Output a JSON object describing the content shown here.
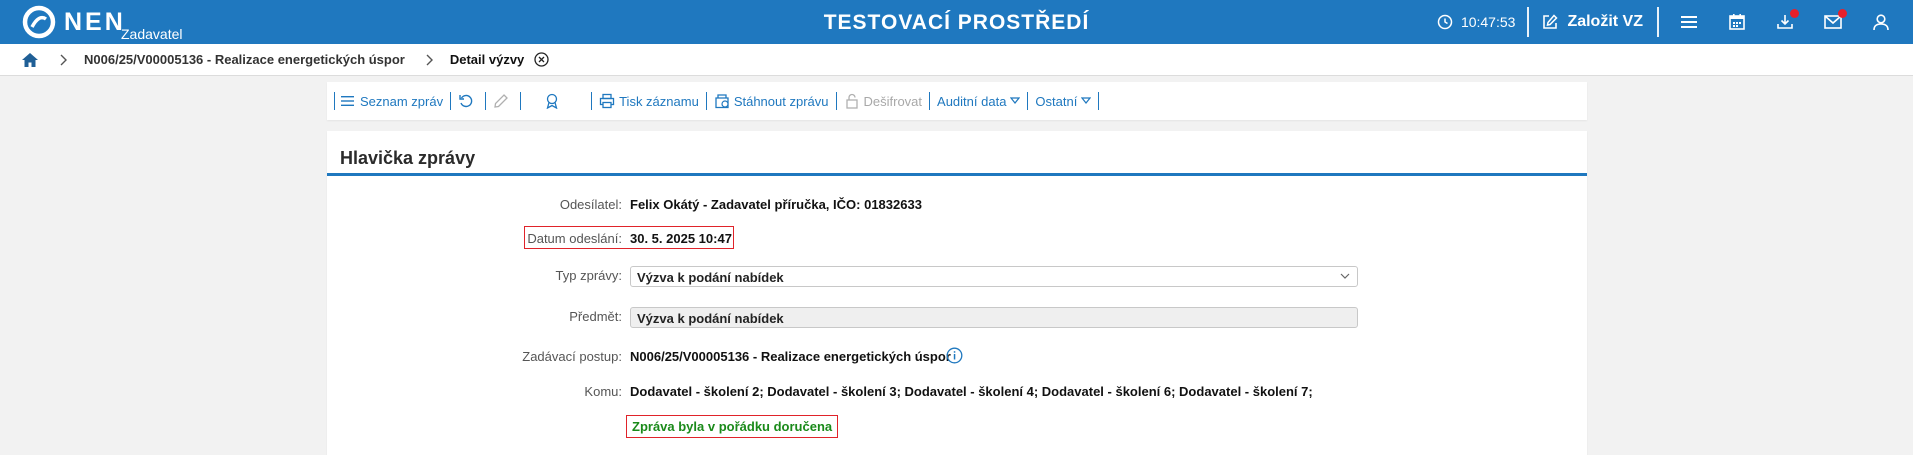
{
  "topbar": {
    "logo_text": "NEN",
    "logo_sub": "Zadavatel",
    "env_title": "TESTOVACÍ PROSTŘEDÍ",
    "time": "10:47:53",
    "create_label": "Založit VZ",
    "icons": [
      "menu-icon",
      "calendar-icon",
      "download-icon",
      "mail-icon",
      "user-icon"
    ],
    "accent_color": "#1f78bf",
    "notification_color": "#e8202a"
  },
  "breadcrumb": {
    "link": "N006/25/V00005136 - Realizace energetických úspor",
    "current": "Detail výzvy"
  },
  "toolbar": {
    "list": "Seznam zpráv",
    "print": "Tisk záznamu",
    "download": "Stáhnout zprávu",
    "decrypt": "Dešifrovat",
    "audit": "Auditní data",
    "other": "Ostatní"
  },
  "header": {
    "title": "Hlavička zprávy",
    "sender_label": "Odesílatel:",
    "sender_value": "Felix Okátý - Zadavatel příručka, IČO: 01832633",
    "sent_label": "Datum odeslání:",
    "sent_value": "30. 5. 2025 10:47",
    "type_label": "Typ zprávy:",
    "type_value": "Výzva k podání nabídek",
    "subject_label": "Předmět:",
    "subject_value": "Výzva k podání nabídek",
    "procedure_label": "Zadávací postup:",
    "procedure_value": "N006/25/V00005136 - Realizace energetických úspor",
    "to_label": "Komu:",
    "to_value": "Dodavatel - školení 2; Dodavatel - školení 3; Dodavatel - školení 4; Dodavatel - školení 6; Dodavatel - školení 7;",
    "status": "Zpráva byla v pořádku doručena"
  }
}
